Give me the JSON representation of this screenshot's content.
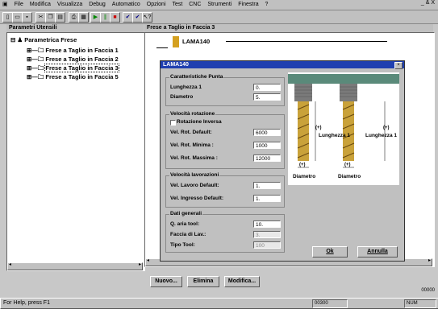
{
  "menu": [
    "File",
    "Modifica",
    "Visualizza",
    "Debug",
    "Automatico",
    "Opzioni",
    "Test",
    "CNC",
    "Strumenti",
    "Finestra",
    "?"
  ],
  "window_controls": "_ & X",
  "left_panel": {
    "title": "Parametri Utensili",
    "root": "Parametrica Frese",
    "items": [
      "Frese a Taglio in Faccia 1",
      "Frese a Taglio in Faccia 2",
      "Frese a Taglio in Faccia 3",
      "Frese a Taglio in Faccia 5"
    ]
  },
  "right_panel": {
    "title": "Frese a Taglio in Faccia 3",
    "tool_name": "LAMA140"
  },
  "dialog": {
    "title": "LAMA140",
    "close": "×",
    "group1": {
      "title": "Caratteristiche Punta",
      "lunghezza_label": "Lunghezza 1",
      "lunghezza_value": "0.",
      "diametro_label": "Diametro",
      "diametro_value": "5."
    },
    "group2": {
      "title": "Velocità rotazione",
      "checkbox_label": "Rotazione Inversa",
      "default_label": "Vel. Rot. Default:",
      "default_value": "6000",
      "min_label": "Vel. Rot. Minima :",
      "min_value": "1000",
      "max_label": "Vel. Rot. Massima :",
      "max_value": "12000"
    },
    "group3": {
      "title": "Velocità lavorazioni",
      "lavoro_label": "Vel. Lavoro Default:",
      "lavoro_value": "1.",
      "ingresso_label": "Vel. Ingresso Default:",
      "ingresso_value": "1."
    },
    "group4": {
      "title": "Dati generali",
      "aria_label": "Q. aria tool:",
      "aria_value": "10.",
      "faccia_label": "Faccia di Lav.:",
      "faccia_value": "3.",
      "tipo_label": "Tipo Tool:",
      "tipo_value": "100"
    },
    "diagram_labels": {
      "len1a": "Lunghezza 1",
      "len1b": "Lunghezza 1",
      "dia_a": "Diametro",
      "dia_b": "Diametro",
      "plus": "(+)"
    },
    "ok_label": "Ok",
    "annulla_label": "Annulla"
  },
  "buttons": {
    "nuovo": "Nuovo...",
    "elimina": "Elimina",
    "modifica": "Modifica..."
  },
  "status": {
    "help": "For Help, press F1",
    "coord": "00000",
    "code": "00300",
    "num": "NUM"
  }
}
